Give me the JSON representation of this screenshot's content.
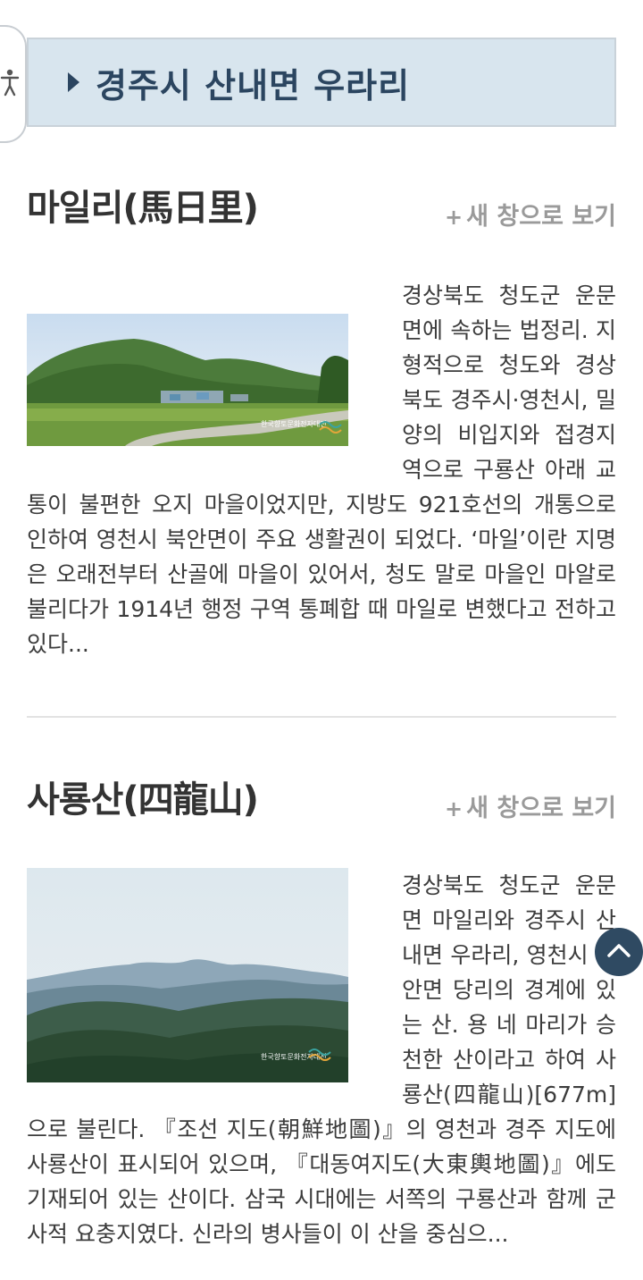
{
  "accessibility": {
    "icon": "accessibility-person-icon"
  },
  "region": {
    "title": "경주시 산내면 우라리",
    "icon": "triangle-right-icon"
  },
  "entries": [
    {
      "title": "마일리(馬日里)",
      "new_window_label": "새 창으로 보기",
      "new_window_icon": "plus-icon",
      "image_watermark": "한국향토문화전자대전",
      "description": "경상북도 청도군 운문면에 속하는 법정리. 지형적으로 청도와 경상북도 경주시·영천시, 밀양의 비입지와 접경지역으로 구룡산 아래 교통이 불편한 오지 마을이었지만, 지방도 921호선의 개통으로 인하여 영천시 북안면이 주요 생활권이 되었다. ‘마일’이란 지명은 오래전부터 산골에 마을이 있어서, 청도 말로 마을인 마알로 불리다가 1914년 행정 구역 통폐합 때 마일로 변했다고 전하고 있다..."
    },
    {
      "title": "사룡산(四龍山)",
      "new_window_label": "새 창으로 보기",
      "new_window_icon": "plus-icon",
      "image_watermark": "한국향토문화전자대전",
      "description": "경상북도 청도군 운문면 마일리와 경주시 산내면 우라리, 영천시 북안면 당리의 경계에 있는 산. 용 네 마리가 승천한 산이라고 하여 사룡산(四龍山)[677m]으로 불린다. 『조선 지도(朝鮮地圖)』의 영천과 경주 지도에 사룡산이 표시되어 있으며, 『대동여지도(大東輿地圖)』에도 기재되어 있는 산이다. 삼국 시대에는 서쪽의 구룡산과 함께 군사적 요충지였다. 신라의 병사들이 이 산을 중심으..."
    }
  ],
  "scroll_top": {
    "icon": "chevron-up-icon"
  },
  "colors": {
    "region_bg": "#d8e5ee",
    "region_text": "#2b4560",
    "scroll_top_bg": "#2f4a62",
    "link_gray": "#9a9a9a"
  }
}
